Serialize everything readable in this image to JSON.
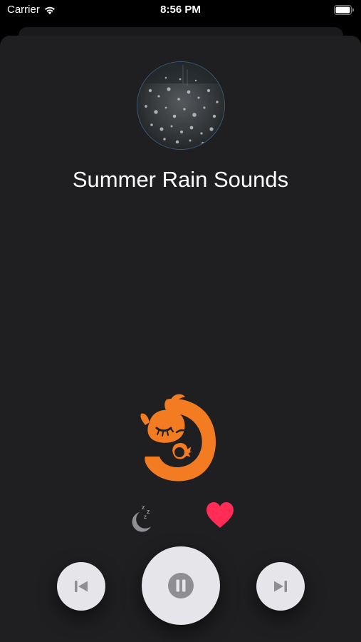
{
  "status_bar": {
    "carrier": "Carrier",
    "time": "8:56 PM",
    "wifi_icon": "wifi-icon",
    "battery_icon": "battery-icon"
  },
  "player": {
    "title": "Summer Rain Sounds",
    "artwork_icon": "rain-drops-artwork",
    "mascot_icon": "sleeping-chameleon-logo",
    "sleep_timer_icon": "moon-zzz-icon",
    "favorite_icon": "heart-icon",
    "controls": {
      "previous_icon": "skip-previous-icon",
      "pause_icon": "pause-icon",
      "next_icon": "skip-next-icon"
    }
  },
  "colors": {
    "background": "#000000",
    "sheet": "#1f1f21",
    "accent_orange": "#f37b21",
    "favorite_red": "#ff2d55",
    "button_bg": "#e5e5ea",
    "icon_gray": "#8e8e93"
  }
}
